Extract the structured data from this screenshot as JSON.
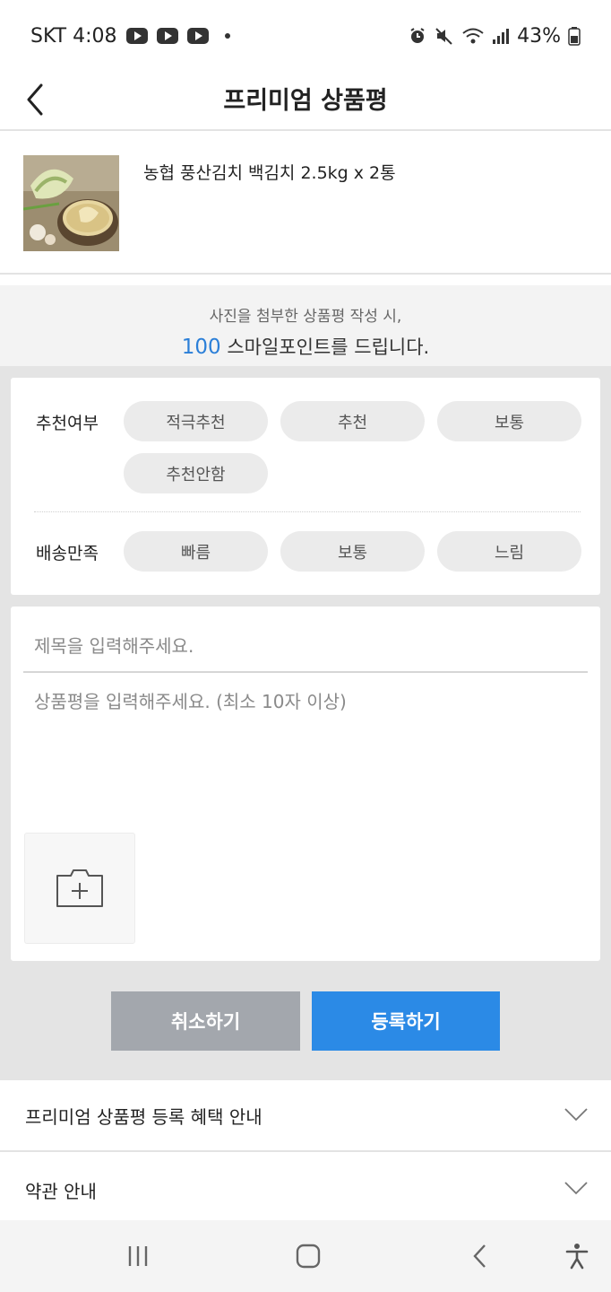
{
  "status_bar": {
    "carrier_time": "SKT 4:08",
    "battery": "43%",
    "icons": [
      "youtube-icon",
      "youtube-icon",
      "youtube-icon",
      "alarm-icon",
      "mute-icon",
      "wifi-icon",
      "signal-icon",
      "battery-icon"
    ]
  },
  "header": {
    "title": "프리미엄 상품평"
  },
  "product": {
    "name": "농협 풍산김치 백김치 2.5kg x 2통"
  },
  "notice": {
    "line1": "사진을 첨부한 상품평 작성 시,",
    "points": "100",
    "line2_rest": " 스마일포인트를 드립니다."
  },
  "rating": {
    "recommend_label": "추천여부",
    "recommend_options": [
      "적극추천",
      "추천",
      "보통",
      "추천안함"
    ],
    "delivery_label": "배송만족",
    "delivery_options": [
      "빠름",
      "보통",
      "느림"
    ]
  },
  "review": {
    "title_placeholder": "제목을 입력해주세요.",
    "body_placeholder": "상품평을 입력해주세요. (최소 10자 이상)"
  },
  "actions": {
    "cancel_label": "취소하기",
    "submit_label": "등록하기"
  },
  "accordions": {
    "benefits_label": "프리미엄 상품평 등록 혜택 안내",
    "terms_label": "약관 안내"
  },
  "colors": {
    "accent": "#2b8ae6",
    "points": "#2b7fd8",
    "cancel": "#a3a7ad"
  }
}
